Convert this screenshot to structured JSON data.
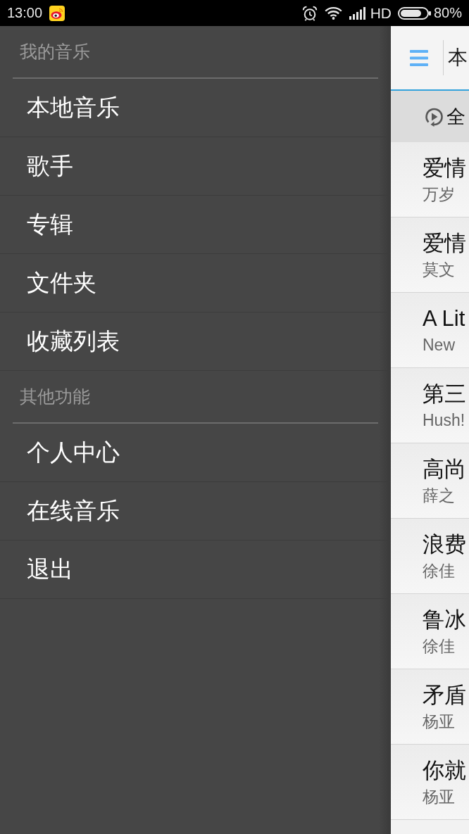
{
  "status_bar": {
    "time": "13:00",
    "network": "HD",
    "battery": "80%"
  },
  "drawer": {
    "sections": [
      {
        "header": "我的音乐",
        "items": [
          "本地音乐",
          "歌手",
          "专辑",
          "文件夹",
          "收藏列表"
        ]
      },
      {
        "header": "其他功能",
        "items": [
          "个人中心",
          "在线音乐",
          "退出"
        ]
      }
    ]
  },
  "main": {
    "app_bar": {
      "title": "本"
    },
    "play_all": {
      "label": "全"
    },
    "songs": [
      {
        "title": "爱情",
        "artist": "万岁"
      },
      {
        "title": "爱情",
        "artist": "莫文"
      },
      {
        "title": "A Lit",
        "artist": "New"
      },
      {
        "title": "第三",
        "artist": "Hush!"
      },
      {
        "title": "高尚",
        "artist": "薛之"
      },
      {
        "title": "浪费",
        "artist": "徐佳"
      },
      {
        "title": "鲁冰",
        "artist": "徐佳"
      },
      {
        "title": "矛盾",
        "artist": "杨亚"
      },
      {
        "title": "你就",
        "artist": "杨亚"
      }
    ]
  }
}
